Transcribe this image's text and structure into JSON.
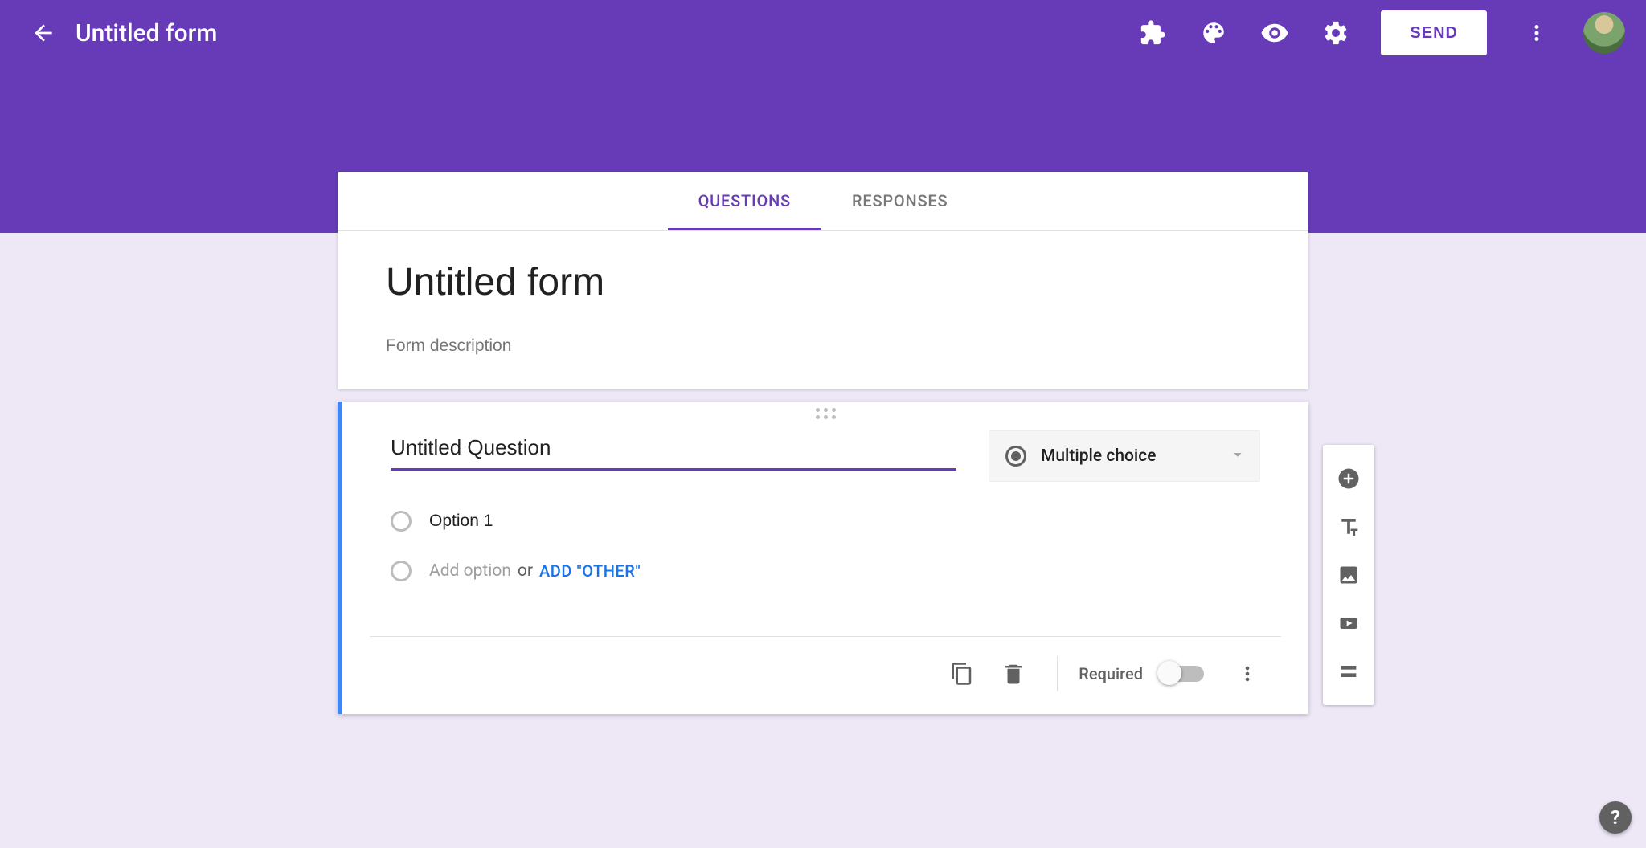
{
  "header": {
    "doc_title": "Untitled form",
    "send_label": "SEND"
  },
  "tabs": {
    "questions": "QUESTIONS",
    "responses": "RESPONSES"
  },
  "form": {
    "title": "Untitled form",
    "description_placeholder": "Form description"
  },
  "question": {
    "title": "Untitled Question",
    "type_label": "Multiple choice",
    "option1": "Option 1",
    "add_option_placeholder": "Add option",
    "or_text": "or",
    "add_other_label": "ADD \"OTHER\"",
    "required_label": "Required"
  },
  "side": {
    "add": "Add question",
    "title": "Add title and description",
    "image": "Add image",
    "video": "Add video",
    "section": "Add section"
  }
}
